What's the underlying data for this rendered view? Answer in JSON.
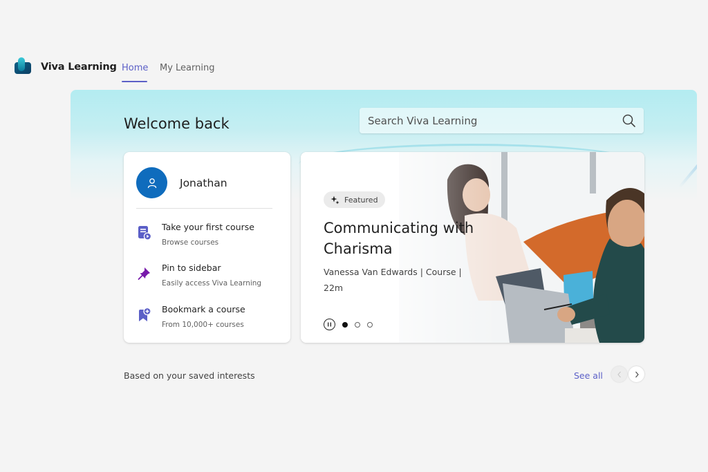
{
  "app": {
    "title": "Viva Learning",
    "logo_icon": "viva-learning-logo"
  },
  "nav": {
    "tabs": [
      {
        "label": "Home",
        "active": true
      },
      {
        "label": "My Learning",
        "active": false
      }
    ]
  },
  "hero": {
    "welcome": "Welcome back",
    "search": {
      "placeholder": "Search Viva Learning",
      "value": "",
      "icon": "search-icon"
    }
  },
  "profile": {
    "name": "Jonathan",
    "avatar_icon": "person-icon",
    "avatar_color": "#0f6cbd",
    "actions": [
      {
        "title": "Take your first course",
        "subtitle": "Browse courses",
        "icon": "course-play-icon"
      },
      {
        "title": "Pin to sidebar",
        "subtitle": "Easily access Viva Learning",
        "icon": "pin-icon"
      },
      {
        "title": "Bookmark a course",
        "subtitle": "From 10,000+ courses",
        "icon": "bookmark-add-icon"
      }
    ]
  },
  "featured": {
    "badge": "Featured",
    "badge_icon": "sparkle-icon",
    "title": "Communicating with Charisma",
    "author": "Vanessa Van Edwards",
    "type": "Course",
    "duration": "22m",
    "meta": "Vanessa Van Edwards | Course | 22m",
    "carousel": {
      "total_slides": 3,
      "active_slide": 1,
      "pause_icon": "pause-icon"
    }
  },
  "section": {
    "title": "Based on your saved interests",
    "see_all": "See all",
    "prev_icon": "chevron-left-icon",
    "next_icon": "chevron-right-icon"
  },
  "colors": {
    "accent": "#5b5fc7",
    "avatar": "#0f6cbd",
    "hero_gradient_top": "#b3ecf1",
    "page_bg": "#f4f4f4",
    "icon_purple": "#5b5fc7",
    "pin_purple": "#7719aa"
  }
}
